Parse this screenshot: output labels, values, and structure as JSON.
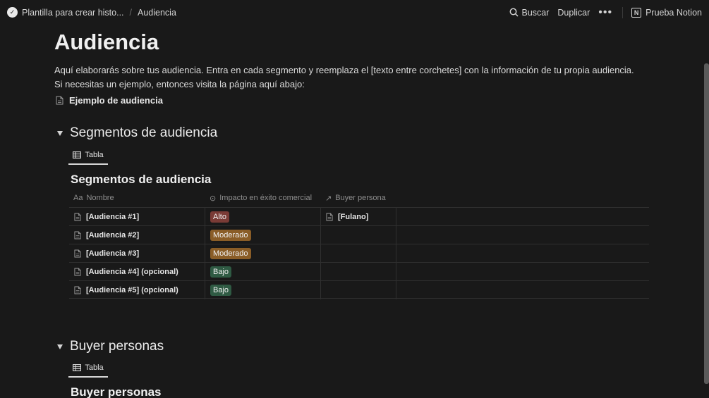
{
  "topbar": {
    "breadcrumb_parent": "Plantilla para crear histo...",
    "breadcrumb_separator": "/",
    "breadcrumb_current": "Audiencia",
    "search_label": "Buscar",
    "duplicate_label": "Duplicar",
    "more_label": "•••",
    "workspace_label": "Prueba Notion"
  },
  "page": {
    "title": "Audiencia",
    "description": "Aquí elaborarás sobre tus audiencia. Entra en cada segmento y reemplaza el [texto entre corchetes] con la información de tu propia audiencia. Si necesitas un ejemplo, entonces visita la página aquí abajo:",
    "example_link": "Ejemplo de audiencia"
  },
  "sections": [
    {
      "heading": "Segmentos de audiencia",
      "tab_label": "Tabla",
      "db_title": "Segmentos de audiencia",
      "columns": [
        {
          "icon": "Aa",
          "label": "Nombre"
        },
        {
          "icon": "⊙",
          "label": "Impacto en éxito comercial"
        },
        {
          "icon": "↗",
          "label": "Buyer persona"
        }
      ],
      "rows": [
        {
          "name": "[Audiencia #1]",
          "impact": "Alto",
          "impact_color": "#7a3b36",
          "persona": "[Fulano]"
        },
        {
          "name": "[Audiencia #2]",
          "impact": "Moderado",
          "impact_color": "#8a5d27",
          "persona": ""
        },
        {
          "name": "[Audiencia #3]",
          "impact": "Moderado",
          "impact_color": "#8a5d27",
          "persona": ""
        },
        {
          "name": "[Audiencia #4] (opcional)",
          "impact": "Bajo",
          "impact_color": "#2f5a43",
          "persona": ""
        },
        {
          "name": "[Audiencia #5] (opcional)",
          "impact": "Bajo",
          "impact_color": "#2f5a43",
          "persona": ""
        }
      ]
    },
    {
      "heading": "Buyer personas",
      "tab_label": "Tabla",
      "db_title": "Buyer personas"
    }
  ]
}
